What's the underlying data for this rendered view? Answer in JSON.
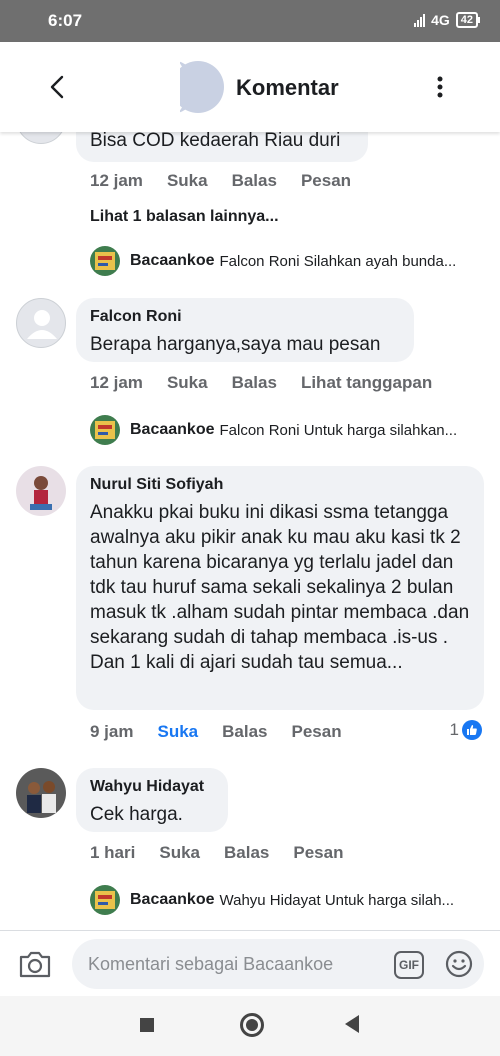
{
  "status": {
    "time": "6:07",
    "network": "4G",
    "battery": "42"
  },
  "header": {
    "title": "Komentar",
    "back_icon": "arrow-left-icon",
    "menu_icon": "more-vertical-icon"
  },
  "comments": [
    {
      "text": "Bisa COD kedaerah Riau duri",
      "time": "12 jam",
      "like": "Suka",
      "reply": "Balas",
      "extra": "Pesan",
      "more_replies": "Lihat 1 balasan lainnya...",
      "page_reply": {
        "name": "Bacaankoe",
        "text": "Falcon Roni Silahkan ayah bunda..."
      }
    },
    {
      "name": "Falcon Roni",
      "text": "Berapa harganya,saya mau pesan",
      "time": "12 jam",
      "like": "Suka",
      "reply": "Balas",
      "extra": "Lihat tanggapan",
      "page_reply": {
        "name": "Bacaankoe",
        "text": "Falcon Roni Untuk harga silahkan..."
      }
    },
    {
      "name": "Nurul Siti Sofiyah",
      "text": "Anakku pkai buku ini dikasi ssma tetangga awalnya aku pikir anak ku mau aku kasi tk 2 tahun karena bicaranya yg terlalu jadel dan tdk tau huruf sama sekali sekalinya 2 bulan masuk tk .alham sudah pintar membaca .dan sekarang sudah di tahap membaca .is-us . Dan 1 kali di ajari sudah tau semua...",
      "time": "9 jam",
      "like": "Suka",
      "reply": "Balas",
      "extra": "Pesan",
      "like_count": "1"
    },
    {
      "name": "Wahyu Hidayat",
      "text": "Cek harga.",
      "time": "1 hari",
      "like": "Suka",
      "reply": "Balas",
      "extra": "Pesan",
      "page_reply": {
        "name": "Bacaankoe",
        "text": "Wahyu Hidayat Untuk harga silah..."
      }
    }
  ],
  "composer": {
    "placeholder": "Komentari sebagai Bacaankoe",
    "gif": "GIF"
  },
  "colors": {
    "accent": "#1877f2",
    "bubble": "#f0f2f5",
    "muted": "#65676b"
  }
}
